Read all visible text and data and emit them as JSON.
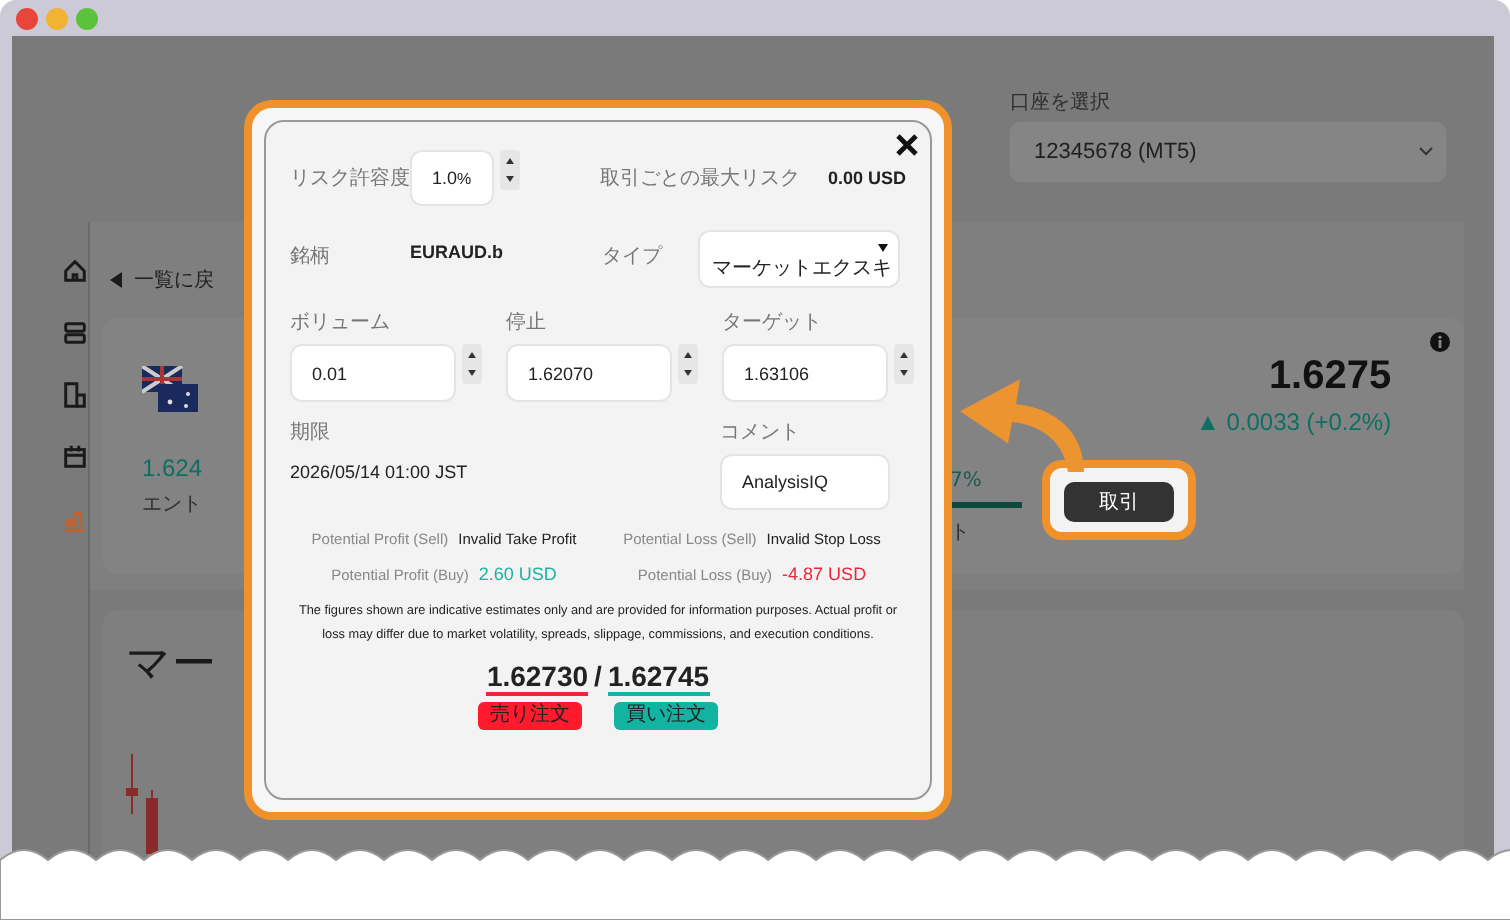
{
  "account": {
    "label": "口座を選択",
    "value": "12345678 (MT5)"
  },
  "sidebar": {
    "items": [
      {
        "kind": "home",
        "selected": false
      },
      {
        "kind": "list",
        "selected": false
      },
      {
        "kind": "document",
        "selected": false
      },
      {
        "kind": "calendar",
        "selected": false
      },
      {
        "kind": "chart",
        "selected": true
      }
    ]
  },
  "back_link": "一覧に戻",
  "instrument": {
    "price": "1.624",
    "price_label": "エント",
    "sentiment": "7%",
    "note": "ト"
  },
  "quote": {
    "price": "1.6275",
    "change": "▲ 0.0033 (+0.2%)"
  },
  "trade_button": "取引",
  "market_title": "マー",
  "modal": {
    "risk_label": "リスク許容度",
    "risk_value": "1.0",
    "risk_unit": "%",
    "max_risk_label": "取引ごとの最大リスク",
    "max_risk_value": "0.00 USD",
    "symbol_label": "銘柄",
    "symbol": "EURAUD.b",
    "type_label": "タイプ",
    "type_value": "マーケットエクスキ",
    "fields": [
      {
        "label": "ボリューム",
        "value": "0.01"
      },
      {
        "label": "停止",
        "value": "1.62070"
      },
      {
        "label": "ターゲット",
        "value": "1.63106"
      }
    ],
    "expiry_label": "期限",
    "expiry": "2026/05/14 01:00 JST",
    "comment_label": "コメント",
    "comment": "AnalysisIQ",
    "estimates": [
      {
        "label": "Potential Profit (Sell)",
        "value": "Invalid Take Profit",
        "color": "#222222"
      },
      {
        "label": "Potential Loss (Sell)",
        "value": "Invalid Stop Loss",
        "color": "#222222"
      },
      {
        "label": "Potential Profit (Buy)",
        "value": "2.60 USD",
        "color": "#19b3a3"
      },
      {
        "label": "Potential Loss (Buy)",
        "value": "-4.87 USD",
        "color": "#f0233a"
      }
    ],
    "disclaimer": "The figures shown are indicative estimates only and are provided for information purposes. Actual profit or loss may differ due to market volatility, spreads, slippage, commissions, and execution conditions.",
    "sell_price": "1.62730",
    "separator": "/",
    "buy_price": "1.62745",
    "sell_button": "売り注文",
    "buy_button": "買い注文"
  }
}
